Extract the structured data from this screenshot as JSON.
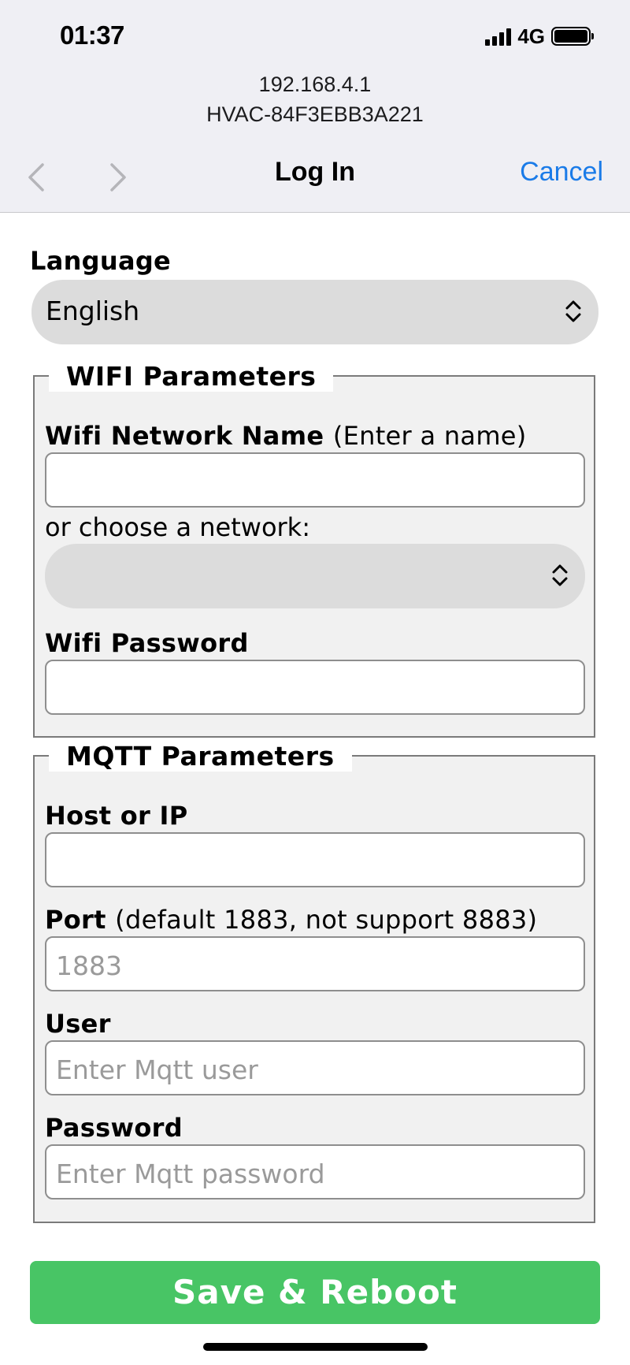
{
  "status": {
    "time": "01:37",
    "network": "4G"
  },
  "browser": {
    "host": "192.168.4.1",
    "page_name": "HVAC-84F3EBB3A221",
    "title": "Log In",
    "cancel_label": "Cancel"
  },
  "form": {
    "language": {
      "label": "Language",
      "selected": "English"
    },
    "wifi": {
      "legend": "WIFI Parameters",
      "network_name_label": "Wifi Network Name",
      "network_name_hint": "(Enter a name)",
      "network_name_value": "",
      "choose_label": "or choose a network:",
      "choose_selected": "",
      "password_label": "Wifi Password",
      "password_value": ""
    },
    "mqtt": {
      "legend": "MQTT Parameters",
      "host_label": "Host or IP",
      "host_value": "",
      "port_label": "Port",
      "port_hint": "(default 1883, not support 8883)",
      "port_placeholder": "1883",
      "user_label": "User",
      "user_placeholder": "Enter Mqtt user",
      "password_label": "Password",
      "password_placeholder": "Enter Mqtt password"
    },
    "submit_label": "Save & Reboot"
  },
  "colors": {
    "accent": "#1a7be8",
    "save_button": "#48c565",
    "chrome_background": "#efeff4",
    "fieldset_background": "#f1f1f1",
    "select_background": "#dcdcdc"
  },
  "icons": {
    "back": "chevron-left-icon",
    "forward": "chevron-right-icon",
    "select": "chevron-up-down-icon",
    "signal": "signal-bars-icon",
    "battery": "battery-icon"
  }
}
